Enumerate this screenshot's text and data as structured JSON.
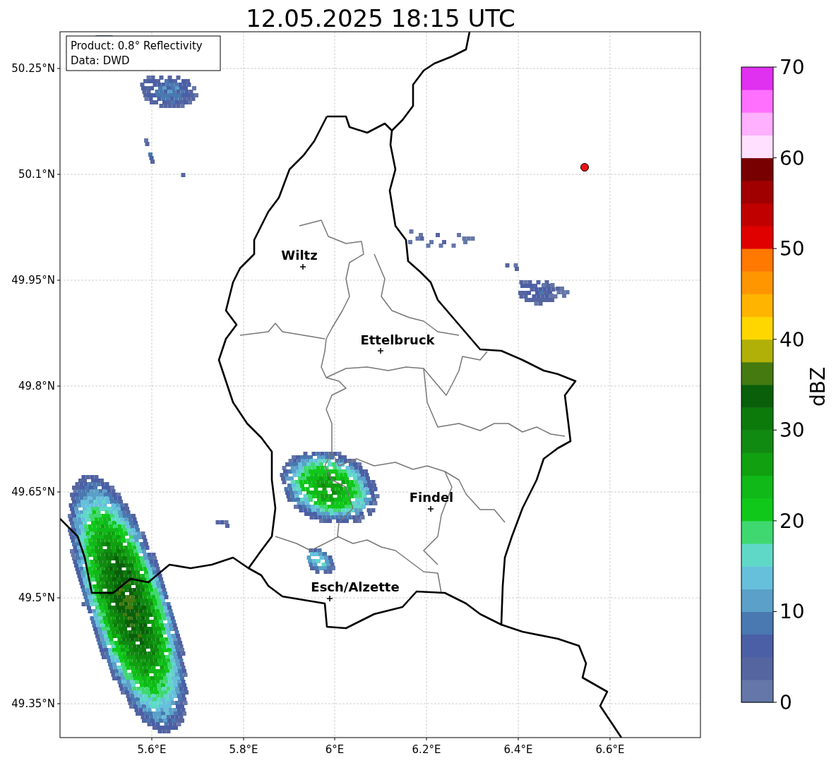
{
  "title": "12.05.2025 18:15 UTC",
  "info_box": {
    "lines": [
      "Product: 0.8° Reflectivity",
      "Data: DWD"
    ]
  },
  "cities": [
    {
      "name": "Wiltz"
    },
    {
      "name": "Ettelbruck"
    },
    {
      "name": "Findel"
    },
    {
      "name": "Esch/Alzette"
    }
  ],
  "y_ticks": [
    "50.25°N",
    "50.1°N",
    "49.95°N",
    "49.8°N",
    "49.65°N",
    "49.5°N",
    "49.35°N"
  ],
  "x_ticks": [
    "5.6°E",
    "5.8°E",
    "6°E",
    "6.2°E",
    "6.4°E",
    "6.6°E"
  ],
  "colorbar": {
    "label": "dBZ",
    "ticks": [
      "70",
      "60",
      "50",
      "40",
      "30",
      "20",
      "10",
      "0"
    ],
    "bands": [
      {
        "color": "#6577a8"
      },
      {
        "color": "#5565a0"
      },
      {
        "color": "#4a5fa5"
      },
      {
        "color": "#4a78b0"
      },
      {
        "color": "#5aa0c8"
      },
      {
        "color": "#66c0dc"
      },
      {
        "color": "#60d8c8"
      },
      {
        "color": "#3fd870"
      },
      {
        "color": "#10c81a"
      },
      {
        "color": "#10b818"
      },
      {
        "color": "#10a010"
      },
      {
        "color": "#108a10"
      },
      {
        "color": "#0b7a0b"
      },
      {
        "color": "#0a5f0a"
      },
      {
        "color": "#457a10"
      },
      {
        "color": "#b0b008"
      },
      {
        "color": "#ffd700"
      },
      {
        "color": "#ffb400"
      },
      {
        "color": "#ff9600"
      },
      {
        "color": "#ff7800"
      },
      {
        "color": "#e00000"
      },
      {
        "color": "#c00000"
      },
      {
        "color": "#a00000"
      },
      {
        "color": "#780000"
      },
      {
        "color": "#ffe0ff"
      },
      {
        "color": "#ffb0ff"
      },
      {
        "color": "#ff70ff"
      },
      {
        "color": "#e030f0"
      }
    ]
  }
}
